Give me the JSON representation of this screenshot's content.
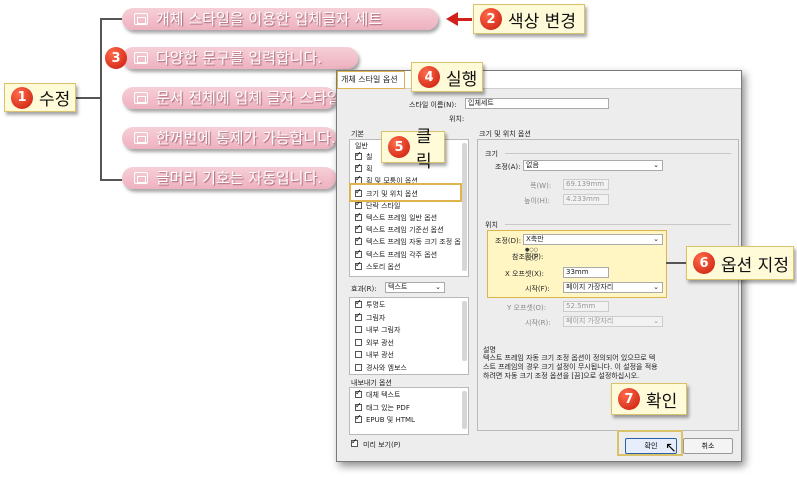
{
  "left_callout": {
    "num": "1",
    "label": "수정"
  },
  "bullets": [
    "개체 스타일을 이용한 입체글자 세트",
    "다양한 문구를 입력합니다.",
    "문서 전체에 입체 글자 스타일",
    "한꺼번에 통제가 가능합니다.",
    "글머리 기호는 자동입니다."
  ],
  "bullet2_num": "3",
  "callouts": {
    "color_change": {
      "num": "2",
      "label": "색상 변경"
    },
    "run": {
      "num": "4",
      "label": "실행"
    },
    "click": {
      "num": "5",
      "label": "클릭"
    },
    "option": {
      "num": "6",
      "label": "옵션 지정"
    },
    "confirm": {
      "num": "7",
      "label": "확인"
    }
  },
  "dialog": {
    "title": "개체 스타일 옵션",
    "style_name_label": "스타일 이름(N):",
    "style_name_value": "입체세트",
    "location_label": "위치:",
    "basic_header": "기본",
    "general_header": "일반",
    "left_items": [
      {
        "label": "칠",
        "checked": true
      },
      {
        "label": "획",
        "checked": true
      },
      {
        "label": "획 및 모퉁이 옵션",
        "checked": true
      },
      {
        "label": "크기 및 위치 옵션",
        "checked": true
      },
      {
        "label": "단락 스타일",
        "checked": true
      },
      {
        "label": "텍스트 프레임 일반 옵션",
        "checked": true
      },
      {
        "label": "텍스트 프레임 기준선 옵션",
        "checked": true
      },
      {
        "label": "텍스트 프레임 자동 크기 조정 옵",
        "checked": true
      },
      {
        "label": "텍스트 프레임 각주 옵션",
        "checked": true
      },
      {
        "label": "스토리 옵션",
        "checked": true
      }
    ],
    "effects_label": "효과(R):",
    "effects_value": "텍스트",
    "effects_items": [
      {
        "label": "투명도",
        "checked": true
      },
      {
        "label": "그림자",
        "checked": true
      },
      {
        "label": "내부 그림자",
        "checked": false
      },
      {
        "label": "외부 광선",
        "checked": false
      },
      {
        "label": "내부 광선",
        "checked": false
      },
      {
        "label": "경사와 엠보스",
        "checked": false
      }
    ],
    "export_header": "내보내기 옵션",
    "export_items": [
      {
        "label": "대체 텍스트",
        "checked": true
      },
      {
        "label": "태그 있는 PDF",
        "checked": true
      },
      {
        "label": "EPUB 및 HTML",
        "checked": true
      }
    ],
    "preview_label": "미리 보기(P)",
    "right_section_title": "크기 및 위치 옵션",
    "size_header": "크기",
    "size_adjust_label": "조정(A):",
    "size_adjust_value": "없음",
    "width_label": "폭(W):",
    "width_value": "69.139mm",
    "height_label": "높이(H):",
    "height_value": "4.233mm",
    "position_header": "위치",
    "pos_adjust_label": "조정(D):",
    "pos_adjust_value": "X축만",
    "ref_point_label": "참조점(P):",
    "x_offset_label": "X 오프셋(X):",
    "x_offset_value": "33mm",
    "start_label": "시작(F):",
    "start_value": "페이지 가장자리",
    "y_offset_label": "Y 오프셋(O):",
    "y_offset_value": "52.5mm",
    "start2_label": "시작(R):",
    "start2_value": "페이지 가장자리",
    "desc_header": "설명",
    "desc_text": "텍스트 프레임 자동 크기 조정 옵션이 정의되어 있으므로 텍스트 프레임의 경우 크기 설정이 무시됩니다. 이 설정을 적용하려면 자동 크기 조정 옵션을 [끔]으로 설정하십시오.",
    "ok_label": "확인",
    "cancel_label": "취소"
  }
}
